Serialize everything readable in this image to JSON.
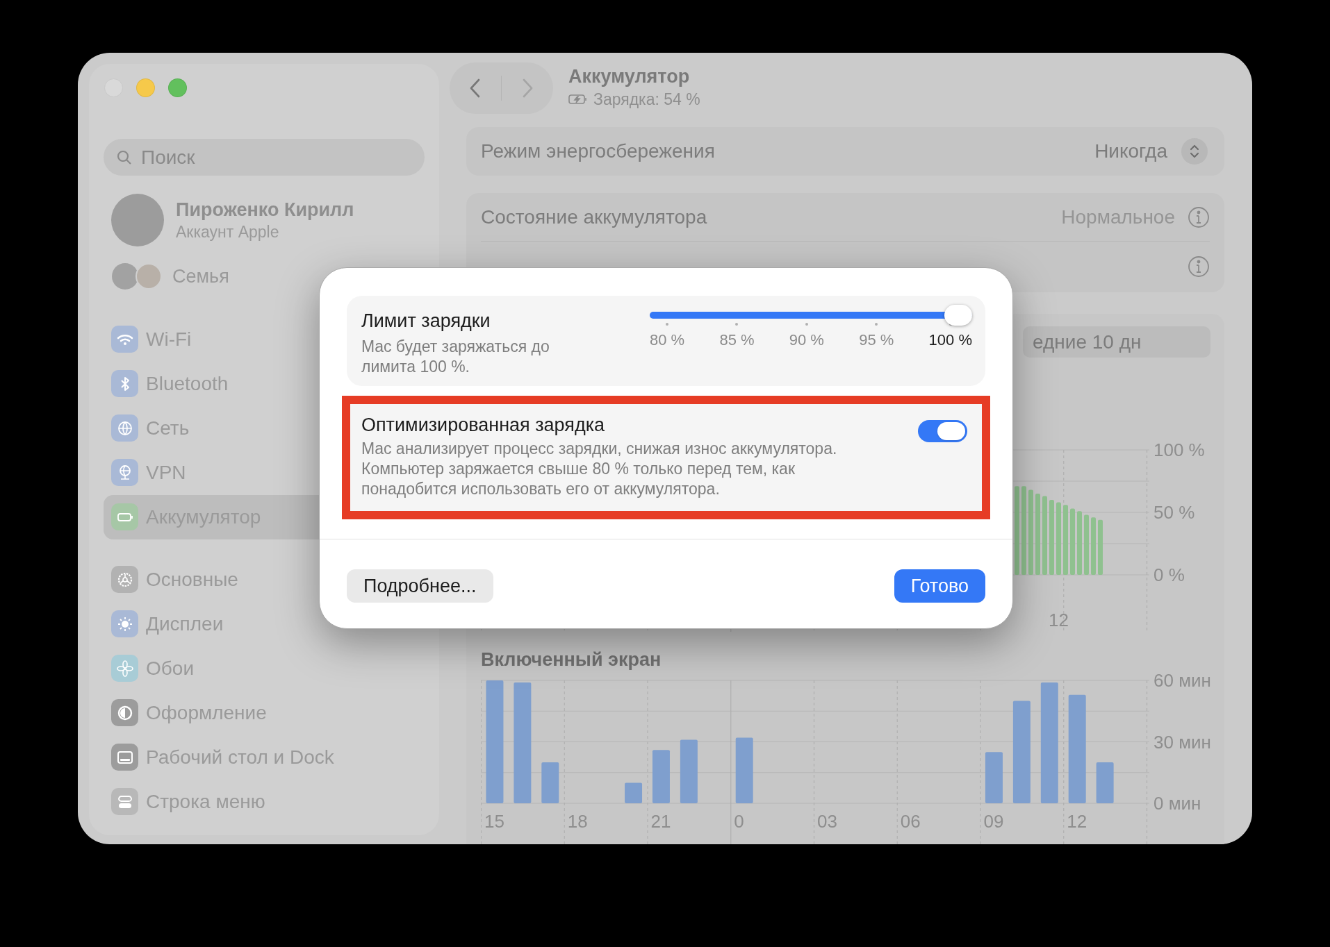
{
  "window": {
    "controls": [
      {
        "kind": "close",
        "disabled": true
      },
      {
        "kind": "minimize",
        "disabled": false
      },
      {
        "kind": "zoom",
        "disabled": false
      }
    ]
  },
  "sidebar": {
    "search": {
      "placeholder": "Поиск"
    },
    "account": {
      "name": "Пироженко Кирилл",
      "subtitle": "Аккаунт Apple"
    },
    "family": {
      "label": "Семья"
    },
    "groups": [
      [
        {
          "label": "Wi-Fi",
          "selected": false
        },
        {
          "label": "Bluetooth",
          "selected": false
        },
        {
          "label": "Сеть",
          "selected": false
        },
        {
          "label": "VPN",
          "selected": false
        },
        {
          "label": "Аккумулятор",
          "selected": true
        }
      ],
      [
        {
          "label": "Основные",
          "selected": false
        },
        {
          "label": "Дисплеи",
          "selected": false
        },
        {
          "label": "Обои",
          "selected": false
        },
        {
          "label": "Оформление",
          "selected": false
        },
        {
          "label": "Рабочий стол и Dock",
          "selected": false
        },
        {
          "label": "Строка меню",
          "selected": false
        }
      ]
    ]
  },
  "toolbar": {
    "title": "Аккумулятор",
    "subtitle": "Зарядка: 54 %"
  },
  "main": {
    "low_power": {
      "label": "Режим энергосбережения",
      "value": "Никогда"
    },
    "battery_health": {
      "label": "Состояние аккумулятора",
      "value": "Нормальное"
    },
    "range_control": {
      "label": "едние 10 дн"
    },
    "battery_chart": {
      "chart_data": {
        "type": "bar",
        "categories": [
          null,
          null,
          null,
          null,
          null,
          null,
          "12",
          null,
          null,
          null,
          null,
          null,
          null
        ],
        "series": [
          {
            "color": "#8fc18f",
            "values": [
              71,
              71,
              68,
              65,
              63,
              60,
              58,
              56,
              53,
              51,
              48,
              46,
              44
            ]
          }
        ],
        "ylim": [
          0,
          100
        ],
        "yticks": [
          {
            "value": 0,
            "label": "0 %"
          },
          {
            "value": 50,
            "label": "50 %"
          },
          {
            "value": 100,
            "label": "100 %"
          }
        ]
      }
    },
    "screen_chart": {
      "title": "Включенный экран",
      "chart_data": {
        "type": "bar",
        "categories": [
          "15",
          null,
          null,
          "18",
          null,
          null,
          "21",
          null,
          null,
          "0",
          null,
          null,
          "03",
          null,
          null,
          "06",
          null,
          null,
          "09",
          null,
          null,
          "12",
          null,
          null
        ],
        "series": [
          {
            "color": "#7f9fce",
            "values": [
              60,
              59,
              20,
              0,
              0,
              10,
              26,
              31,
              0,
              32,
              0,
              0,
              0,
              0,
              0,
              0,
              0,
              0,
              25,
              50,
              59,
              53,
              20,
              0
            ]
          }
        ],
        "ylim": [
          0,
          60
        ],
        "yticks": [
          {
            "value": 0,
            "label": "0 мин"
          },
          {
            "value": 30,
            "label": "30 мин"
          },
          {
            "value": 60,
            "label": "60 мин"
          }
        ]
      }
    }
  },
  "dialog": {
    "charge_limit": {
      "title": "Лимит зарядки",
      "description": "Mac будет заряжаться до лимита 100 %.",
      "slider": {
        "level": 1,
        "ticks": [
          {
            "label": "80 %",
            "selected": false
          },
          {
            "label": "85 %",
            "selected": false
          },
          {
            "label": "90 %",
            "selected": false
          },
          {
            "label": "95 %",
            "selected": false
          },
          {
            "label": "100 %",
            "selected": true
          }
        ]
      }
    },
    "optimized_charging": {
      "title": "Оптимизированная зарядка",
      "description": "Mac анализирует процесс зарядки, снижая износ аккумулятора. Компьютер заряжается свыше 80 % только перед тем, как понадобится использовать его от аккумулятора.",
      "on": true,
      "highlighted": true
    },
    "buttons": [
      {
        "label": "Подробнее...",
        "kind": "secondary"
      },
      {
        "label": "Готово",
        "kind": "primary"
      }
    ]
  }
}
